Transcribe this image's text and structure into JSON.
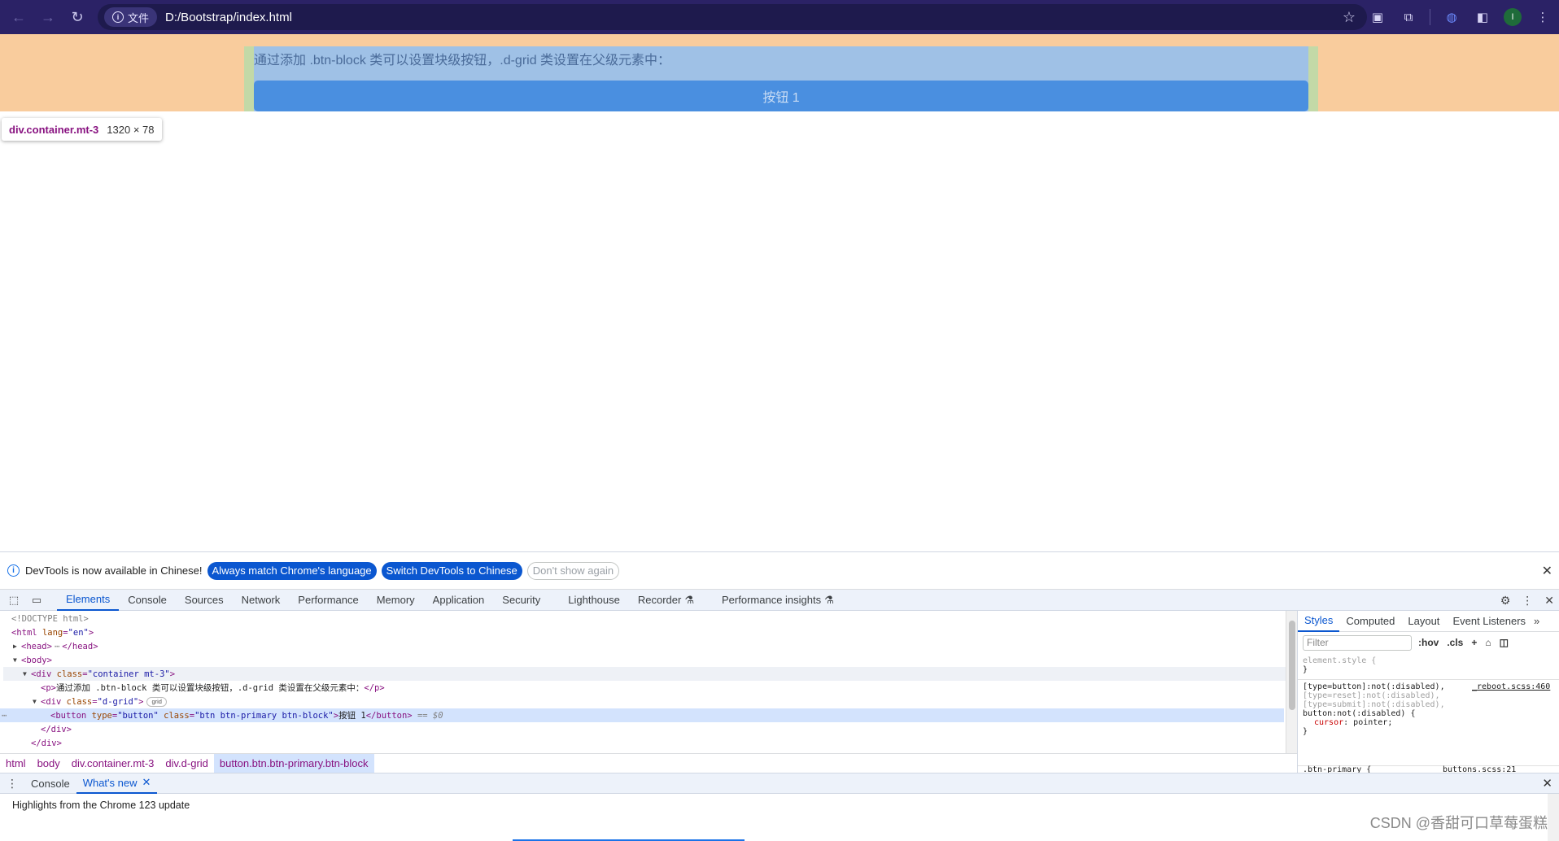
{
  "browser": {
    "url_chip": "文件",
    "url": "D:/Bootstrap/index.html",
    "avatar_letter": "I"
  },
  "page": {
    "paragraph": "通过添加 .btn-block 类可以设置块级按钮，.d-grid 类设置在父级元素中：",
    "button_label": "按钮 1",
    "tooltip_tag": "div.container.mt-3",
    "tooltip_dims": "1320 × 78"
  },
  "infobar": {
    "message": "DevTools is now available in Chinese!",
    "btn_match": "Always match Chrome's language",
    "btn_switch": "Switch DevTools to Chinese",
    "btn_dismiss": "Don't show again"
  },
  "devtools_tabs": [
    "Elements",
    "Console",
    "Sources",
    "Network",
    "Performance",
    "Memory",
    "Application",
    "Security",
    "Lighthouse",
    "Recorder",
    "Performance insights"
  ],
  "dom": {
    "doctype": "<!DOCTYPE html>",
    "html_open": "<html",
    "html_attr": "lang",
    "html_val": "\"en\"",
    "head": "<head>",
    "head_ellipsis": "⋯",
    "head_close": "</head>",
    "body": "<body>",
    "container_open": "<div",
    "container_attr": "class",
    "container_val": "\"container mt-3\"",
    "p_open": "<p>",
    "p_text": "通过添加 .btn-block 类可以设置块级按钮，.d-grid 类设置在父级元素中：",
    "p_close": "</p>",
    "grid_open": "<div",
    "grid_attr": "class",
    "grid_val": "\"d-grid\"",
    "grid_badge": "grid",
    "btn_open": "<button",
    "btn_type_attr": "type",
    "btn_type_val": "\"button\"",
    "btn_class_attr": "class",
    "btn_class_val": "\"btn btn-primary btn-block\"",
    "btn_text": "按钮 1",
    "btn_close": "</button>",
    "btn_eq": "== $0",
    "div_close": "</div>",
    "div_close2": "</div>"
  },
  "breadcrumbs": [
    "html",
    "body",
    "div.container.mt-3",
    "div.d-grid",
    "button.btn.btn-primary.btn-block"
  ],
  "styles": {
    "tabs": [
      "Styles",
      "Computed",
      "Layout",
      "Event Listeners"
    ],
    "filter_placeholder": "Filter",
    "hov": ":hov",
    "cls": ".cls",
    "element_style": "element.style {",
    "close_brace": "}",
    "rule1_sel1": "[type=button]:not(:disabled),",
    "rule1_src": "_reboot.scss:460",
    "rule1_sel2": "[type=reset]:not(:disabled),",
    "rule1_sel3": "[type=submit]:not(:disabled),",
    "rule1_sel4": "button:not(:disabled) {",
    "rule1_prop": "cursor",
    "rule1_val": "pointer;",
    "rule2_sel": ".btn-primary {",
    "rule2_src": "buttons.scss:21"
  },
  "drawer": {
    "tabs": [
      "Console",
      "What's new"
    ],
    "highlights": "Highlights from the Chrome 123 update"
  },
  "watermark": "CSDN @香甜可口草莓蛋糕"
}
